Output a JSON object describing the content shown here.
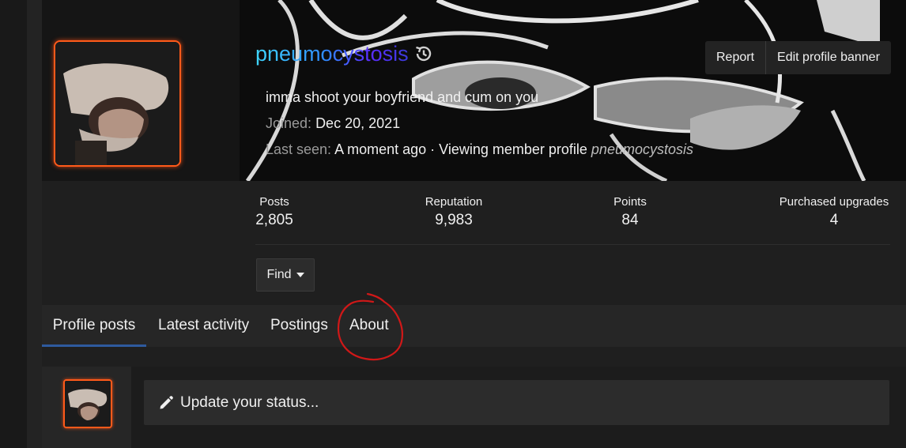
{
  "profile": {
    "username": "pneumocystosis",
    "status_message": "imma shoot your boyfriend and cum on you",
    "joined_label": "Joined:",
    "joined_value": "Dec 20, 2021",
    "last_seen_label": "Last seen:",
    "last_seen_value": "A moment ago · Viewing member profile",
    "last_seen_target": "pneumocystosis"
  },
  "actions": {
    "report_label": "Report",
    "edit_banner_label": "Edit profile banner",
    "find_label": "Find"
  },
  "stats": [
    {
      "label": "Posts",
      "value": "2,805"
    },
    {
      "label": "Reputation",
      "value": "9,983"
    },
    {
      "label": "Points",
      "value": "84"
    },
    {
      "label": "Purchased upgrades",
      "value": "4"
    }
  ],
  "tabs": [
    {
      "label": "Profile posts",
      "active": true
    },
    {
      "label": "Latest activity",
      "active": false
    },
    {
      "label": "Postings",
      "active": false
    },
    {
      "label": "About",
      "active": false
    }
  ],
  "status_update": {
    "placeholder": "Update your status..."
  },
  "colors": {
    "accent_avatar_border": "#ff5a1a",
    "active_tab_underline": "#2e5a9e",
    "annotation": "#d01818"
  },
  "icons": [
    "history-icon",
    "caret-down-icon",
    "pencil-icon"
  ]
}
